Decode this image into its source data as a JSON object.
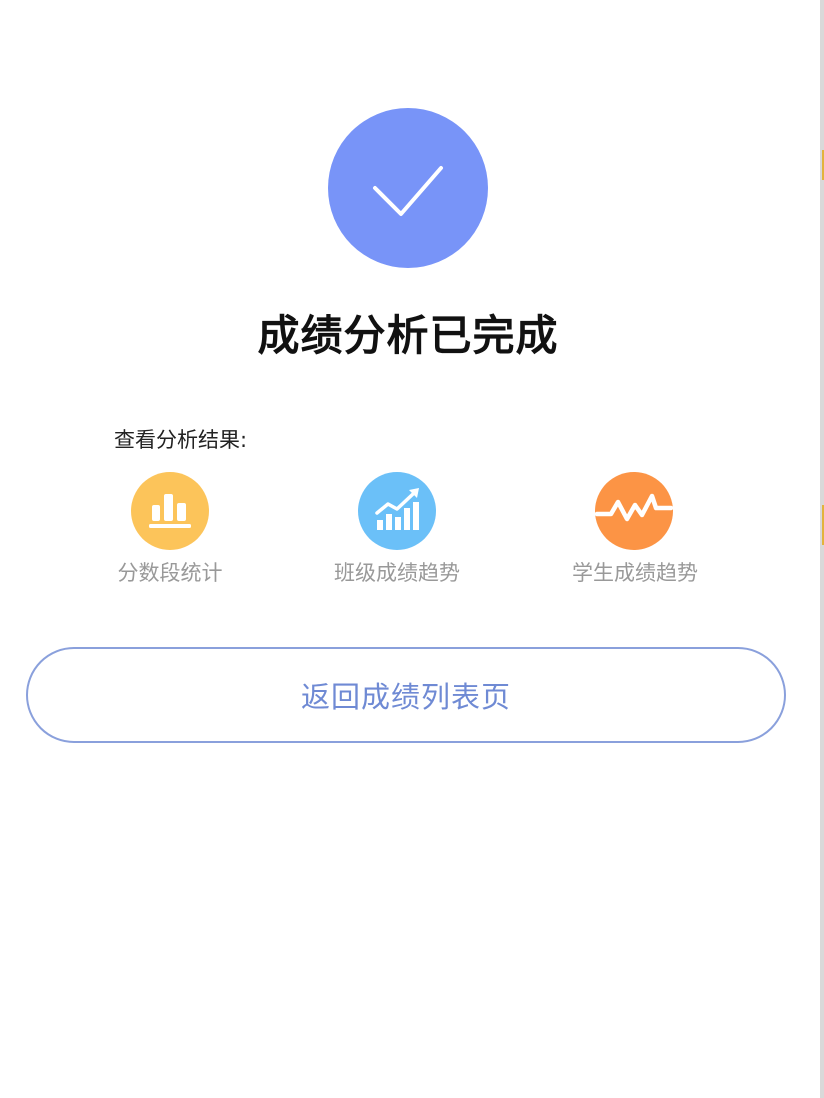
{
  "result": {
    "status_icon": "checkmark-icon",
    "title": "成绩分析已完成"
  },
  "results_section": {
    "label": "查看分析结果:",
    "actions": [
      {
        "label": "分数段统计",
        "icon": "bar-chart-icon",
        "color": "#fcc45a"
      },
      {
        "label": "班级成绩趋势",
        "icon": "rising-chart-icon",
        "color": "#6bc0f8"
      },
      {
        "label": "学生成绩趋势",
        "icon": "zigzag-line-icon",
        "color": "#fc9445"
      }
    ]
  },
  "return_button": {
    "label": "返回成绩列表页"
  },
  "colors": {
    "accent": "#7894f8",
    "button_text": "#6f8ad4",
    "button_border": "#8aa0dc"
  }
}
